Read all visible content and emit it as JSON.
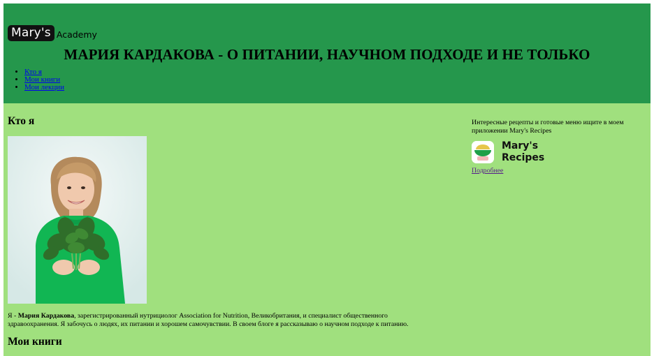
{
  "header": {
    "logo_badge": "Mary's",
    "logo_text": "Academy",
    "title": "МАРИЯ КАРДАКОВА - О ПИТАНИИ, НАУЧНОМ ПОДХОДЕ И НЕ ТОЛЬКО",
    "nav": [
      {
        "label": "Кто я"
      },
      {
        "label": "Мои книги"
      },
      {
        "label": "Мои лекции"
      }
    ],
    "background_color": "#25974c"
  },
  "main": {
    "background_color": "#a0e07e",
    "about_heading": "Кто я",
    "portrait_icon": "portrait-photo",
    "bio": {
      "prefix": "Я - ",
      "name": "Мария Кардакова",
      "text": ", зарегистрированный нутрициолог Association for Nutrition, Великобритания, и специалист общественного здравоохранения. Я забочусь о людях, их питании и хорошем самочувствии. В своем блоге я рассказываю о научном подходе к питанию."
    },
    "books_heading": "Мои книги"
  },
  "aside": {
    "promo_text": "Интересные рецепты и готовые меню ищите в моем приложении Mary's Recipes",
    "app_icon": "marys-recipes-app-icon",
    "app_name_line1": "Mary's",
    "app_name_line2": "Recipes",
    "more_link": "Подробнее"
  }
}
